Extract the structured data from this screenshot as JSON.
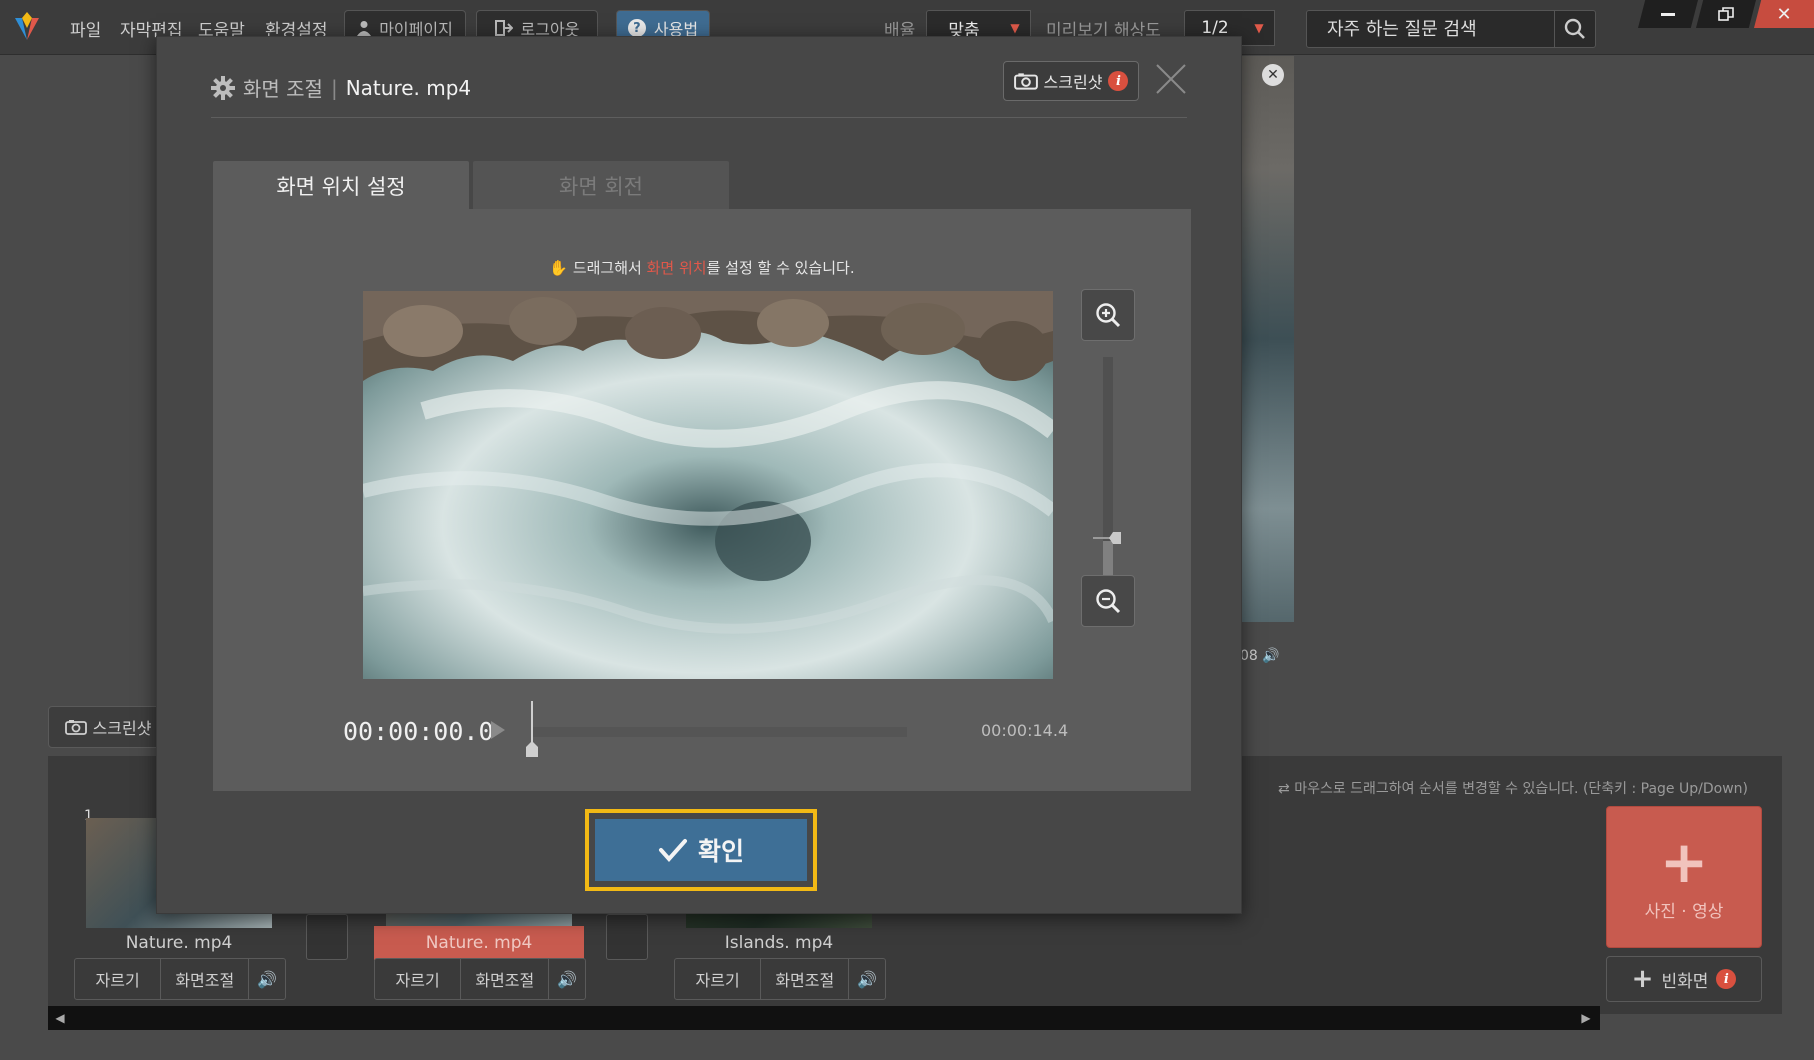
{
  "menu": {
    "items": [
      "파일",
      "자막편집",
      "도움말",
      "환경설정"
    ]
  },
  "topbar": {
    "mypage_label": "마이페이지",
    "logout_label": "로그아웃",
    "manual_label": "사용법",
    "ratio_label": "배율",
    "ratio_value": "맞춤",
    "preview_res_label": "미리보기 해상도",
    "preview_res_value": "1/2",
    "search_placeholder": "자주 하는 질문 검색"
  },
  "background": {
    "screenshot_label": "스크린샷",
    "preview_time_fragment": "08",
    "drag_order_hint": "마우스로 드래그하여 순서를 변경할 수 있습니다. (단축키 : Page Up/Down)",
    "add_media_label": "사진 · 영상",
    "blank_screen_label": "빈화면",
    "clips": [
      {
        "number": "1",
        "name": "Nature. mp4",
        "cut": "자르기",
        "adjust": "화면조절",
        "selected": false
      },
      {
        "number": "",
        "name": "Nature. mp4",
        "cut": "자르기",
        "adjust": "화면조절",
        "selected": true
      },
      {
        "number": "",
        "name": "Islands. mp4",
        "cut": "자르기",
        "adjust": "화면조절",
        "selected": false
      }
    ]
  },
  "dialog": {
    "title": "화면 조절",
    "filename": "Nature. mp4",
    "screenshot_label": "스크린샷",
    "tabs": [
      {
        "label": "화면 위치 설정",
        "active": true
      },
      {
        "label": "화면 회전",
        "active": false
      }
    ],
    "drag_hint_before": "드래그해서 ",
    "drag_hint_highlight": "화면 위치",
    "drag_hint_after": "를 설정 할 수 있습니다.",
    "zoom_level": 0.28,
    "playback_progress": 0,
    "time_current": "00:00:00.0",
    "time_end": "00:00:14.4",
    "confirm_label": "확인"
  },
  "colors": {
    "accent_blue": "#3e6f96",
    "highlight_red": "#e0584a",
    "focus_outline": "#f2b915",
    "add_button": "#c85b4f"
  }
}
